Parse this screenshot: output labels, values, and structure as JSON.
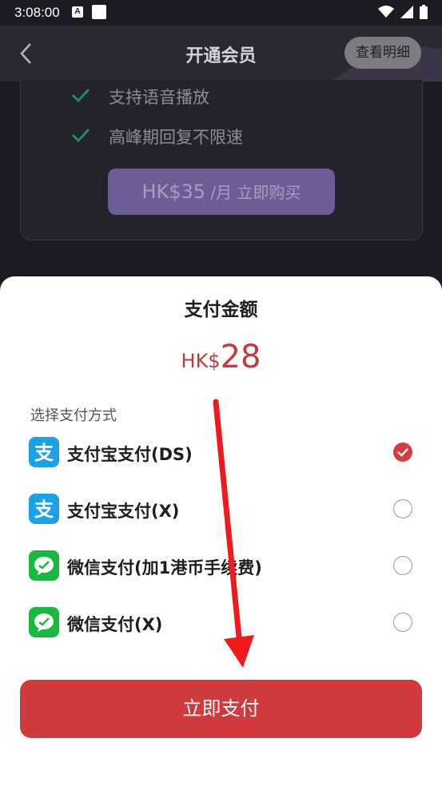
{
  "status_bar": {
    "time": "3:08:00",
    "indicator": "A"
  },
  "header": {
    "title": "开通会员",
    "details_label": "查看明细"
  },
  "features": [
    "支持语音播放",
    "高峰期回复不限速"
  ],
  "buy_button": {
    "price": "HK$35",
    "suffix": "/月 立即购买"
  },
  "sheet": {
    "title": "支付金额",
    "currency": "HK$",
    "amount": "28",
    "method_label": "选择支付方式",
    "methods": [
      {
        "label": "支付宝支付(DS)",
        "icon": "alipay-icon",
        "selected": true
      },
      {
        "label": "支付宝支付(X)",
        "icon": "alipay-icon",
        "selected": false
      },
      {
        "label": "微信支付(加1港币手续费)",
        "icon": "wechat-icon",
        "selected": false
      },
      {
        "label": "微信支付(X)",
        "icon": "wechat-icon",
        "selected": false
      }
    ],
    "pay_label": "立即支付"
  },
  "colors": {
    "accent": "#d0393d",
    "alipay": "#1ba1e6",
    "wechat": "#19b93f",
    "purple": "#6d5c95"
  }
}
